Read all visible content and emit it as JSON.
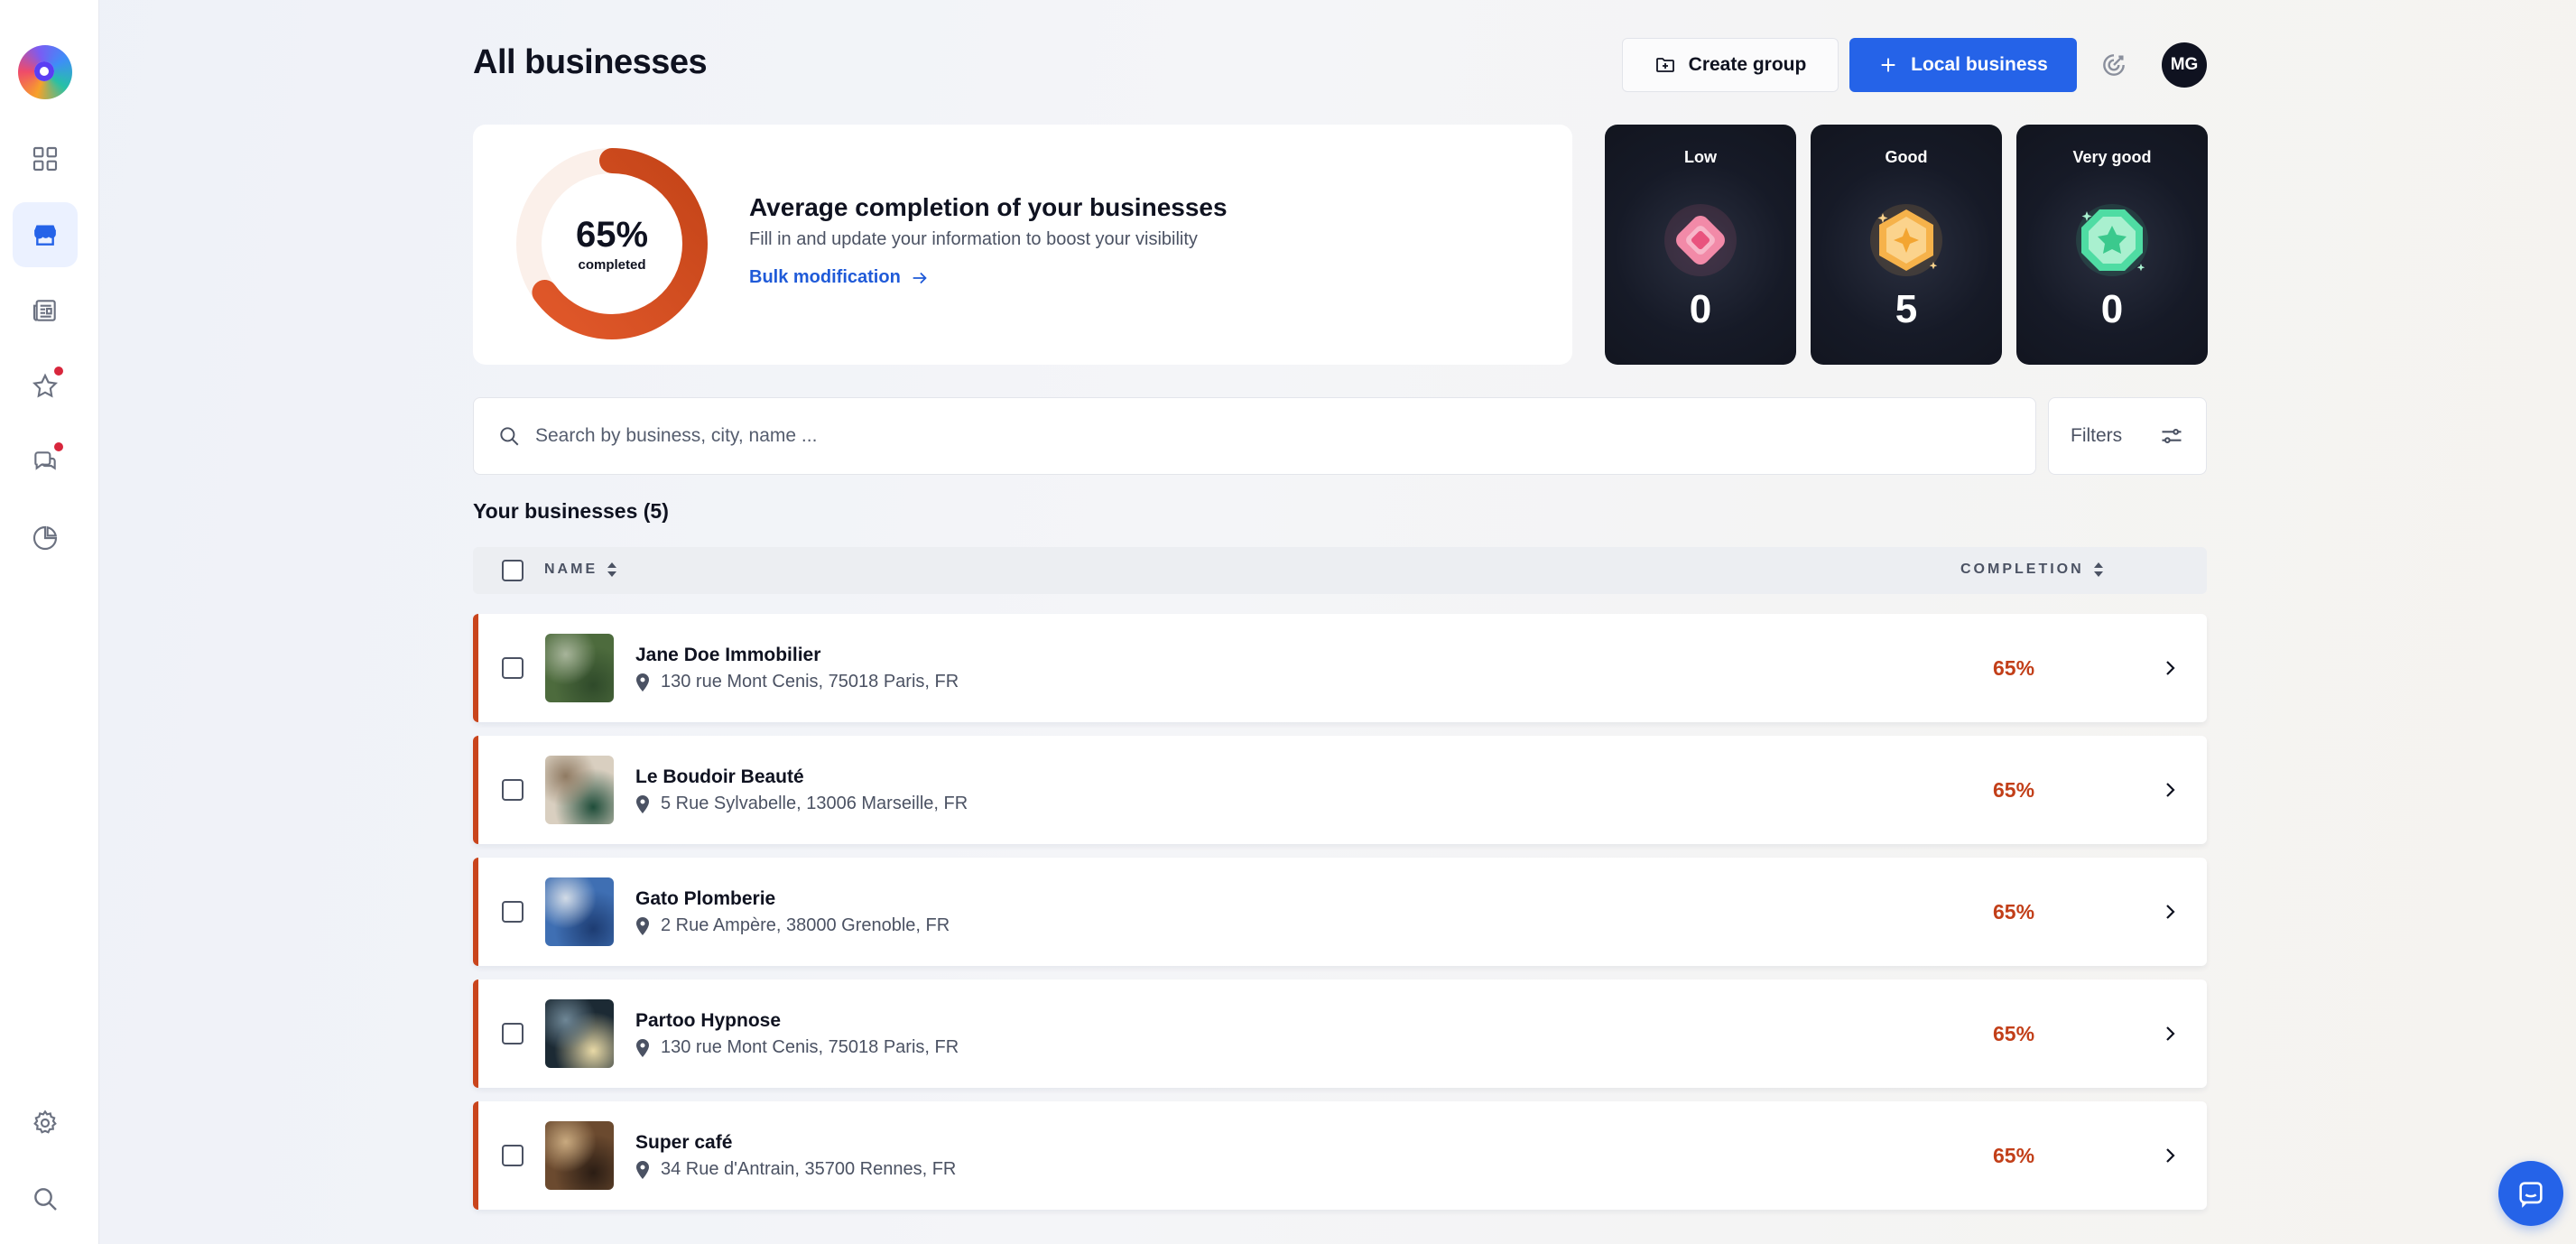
{
  "header": {
    "title": "All businesses",
    "create_group_label": "Create group",
    "local_business_label": "Local business",
    "avatar_initials": "MG"
  },
  "sidebar": {
    "items": [
      {
        "name": "dashboard",
        "icon": "grid-icon",
        "active": false,
        "notification": false
      },
      {
        "name": "businesses",
        "icon": "store-icon",
        "active": true,
        "notification": false
      },
      {
        "name": "posts",
        "icon": "newspaper-icon",
        "active": false,
        "notification": false
      },
      {
        "name": "reviews",
        "icon": "star-icon",
        "active": false,
        "notification": true
      },
      {
        "name": "messages",
        "icon": "chat-icon",
        "active": false,
        "notification": true
      },
      {
        "name": "analytics",
        "icon": "chart-icon",
        "active": false,
        "notification": false
      }
    ],
    "bottom": [
      {
        "name": "settings",
        "icon": "gear-icon"
      },
      {
        "name": "search",
        "icon": "search-icon"
      }
    ]
  },
  "completion": {
    "percent": 65,
    "percent_label": "65%",
    "completed_label": "completed",
    "title": "Average completion of your businesses",
    "subtitle": "Fill in and update your information to boost your visibility",
    "bulk_link": "Bulk modification"
  },
  "scores": [
    {
      "label": "Low",
      "value": "0",
      "color": "#f06d93"
    },
    {
      "label": "Good",
      "value": "5",
      "color": "#f6b24a"
    },
    {
      "label": "Very good",
      "value": "0",
      "color": "#3fd498"
    }
  ],
  "search": {
    "placeholder": "Search by business, city, name ...",
    "filters_label": "Filters"
  },
  "list": {
    "title": "Your businesses (5)",
    "columns": {
      "name": "NAME",
      "completion": "COMPLETION"
    },
    "rows": [
      {
        "name": "Jane Doe Immobilier",
        "address": "130 rue Mont Cenis, 75018 Paris, FR",
        "completion": "65%",
        "thumb": [
          "#4d6b3d",
          "#a7b49a",
          "#2f4a2a"
        ]
      },
      {
        "name": "Le Boudoir Beauté",
        "address": "5 Rue Sylvabelle, 13006 Marseille, FR",
        "completion": "65%",
        "thumb": [
          "#d9cfc0",
          "#8f7a62",
          "#1f4d3a"
        ]
      },
      {
        "name": "Gato Plomberie",
        "address": "2 Rue Ampère, 38000 Grenoble, FR",
        "completion": "65%",
        "thumb": [
          "#3f6fb3",
          "#d2dbe6",
          "#1d3c72"
        ]
      },
      {
        "name": "Partoo Hypnose",
        "address": "130 rue Mont Cenis, 75018 Paris, FR",
        "completion": "65%",
        "thumb": [
          "#1c2a34",
          "#6f8796",
          "#e8d9a6"
        ]
      },
      {
        "name": "Super café",
        "address": "34 Rue d'Antrain, 35700 Rennes, FR",
        "completion": "65%",
        "thumb": [
          "#6b4a2f",
          "#c8a97f",
          "#2b1d14"
        ]
      }
    ]
  },
  "colors": {
    "accent": "#2563e8",
    "completion": "#c9441c",
    "text": "#0f1220"
  }
}
